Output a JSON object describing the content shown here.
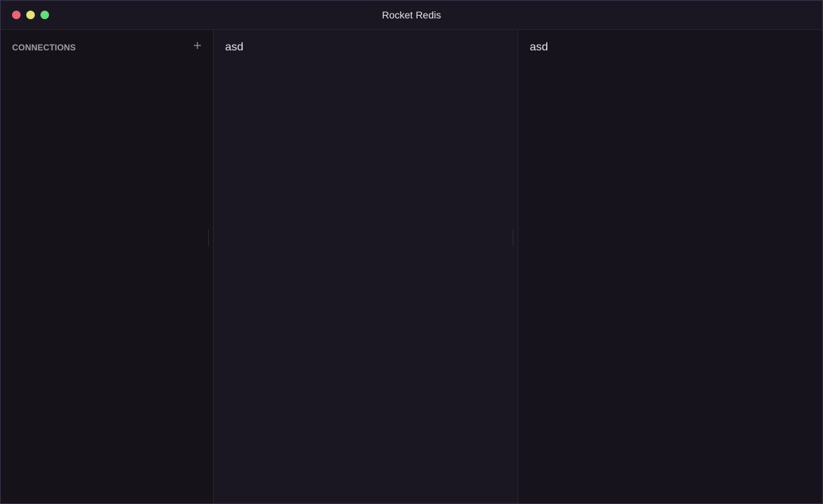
{
  "window": {
    "title": "Rocket Redis"
  },
  "sidebar": {
    "header": "CONNECTIONS",
    "add_icon": "plus-icon"
  },
  "keys_panel": {
    "title": "asd"
  },
  "value_panel": {
    "title": "asd"
  },
  "colors": {
    "close": "#e8647a",
    "minimize": "#e6e27a",
    "maximize": "#66dc7c",
    "background": "#15121a",
    "panel": "#1b1722"
  }
}
